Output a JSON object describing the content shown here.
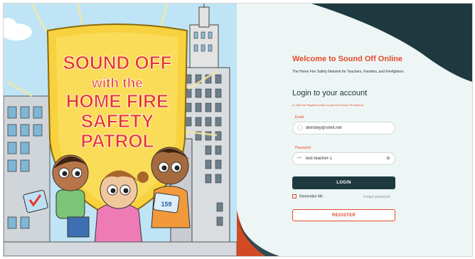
{
  "art": {
    "title_line1": "SOUND OFF",
    "title_line2": "with the",
    "title_line3": "HOME FIRE",
    "title_line4": "SAFETY",
    "title_line5": "PATROL",
    "card_text": "159"
  },
  "login": {
    "welcome": "Welcome to Sound Off Online",
    "tagline": "The Home Fire Safety Network for Teachers, Families, and Firefighters.",
    "title": "Login to your account",
    "register_hint": "or click the Register button to join the Sound Off network.",
    "email_label": "Email",
    "email_value": "dkinsley@sneit.net",
    "password_label": "Password",
    "password_value": "test-teacher-1",
    "login_button": "LOGIN",
    "remember_me": "Remember Me",
    "forgot_password": "Forgot password",
    "register_button": "REGISTER"
  },
  "colors": {
    "accent": "#e24a2b",
    "dark_teal": "#1e3a40",
    "panel_bg": "#eef6f5",
    "shield_yellow": "#f7d23e"
  },
  "icons": {
    "email_icon": "user-circle-icon",
    "password_icon": "key-icon",
    "show_password_icon": "eye-icon"
  }
}
